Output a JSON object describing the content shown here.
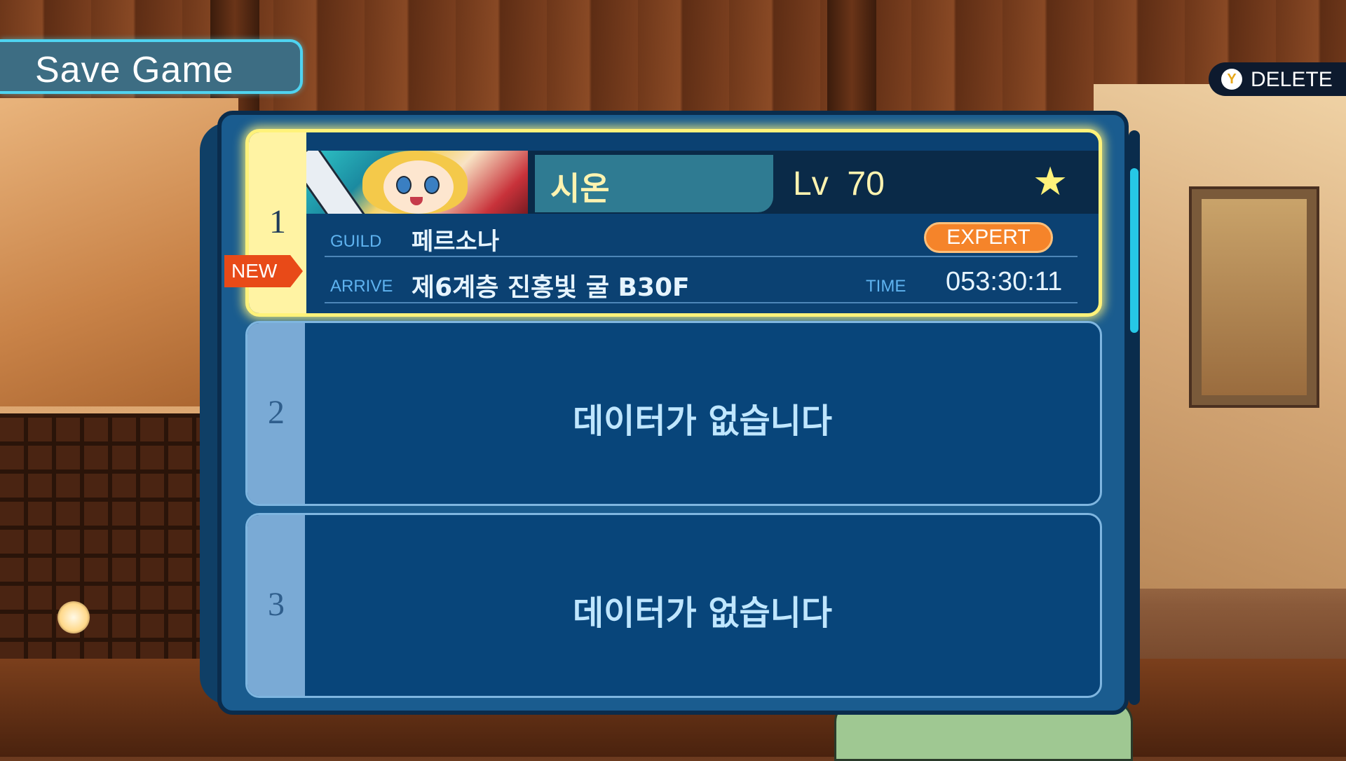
{
  "header": {
    "title": "Save Game"
  },
  "controls": {
    "delete_button_glyph": "Y",
    "delete_label": "DELETE"
  },
  "slots": [
    {
      "number": "1",
      "new_badge": "NEW",
      "name": "시온",
      "level_label": "Lv",
      "level_value": "70",
      "guild_label": "GUILD",
      "guild_value": "페르소나",
      "difficulty": "EXPERT",
      "arrive_label": "ARRIVE",
      "arrive_value": "제6계층 진홍빛 굴 B30F",
      "time_label": "TIME",
      "time_value": "053:30:11",
      "star": "★"
    },
    {
      "number": "2",
      "empty_text": "데이터가 없습니다"
    },
    {
      "number": "3",
      "empty_text": "데이터가 없습니다"
    }
  ],
  "colors": {
    "accent_cyan": "#4fd3f0",
    "selection_yellow": "#fff27a",
    "expert_orange": "#f5842a",
    "new_red": "#e84a18",
    "panel_blue": "#08457a"
  }
}
